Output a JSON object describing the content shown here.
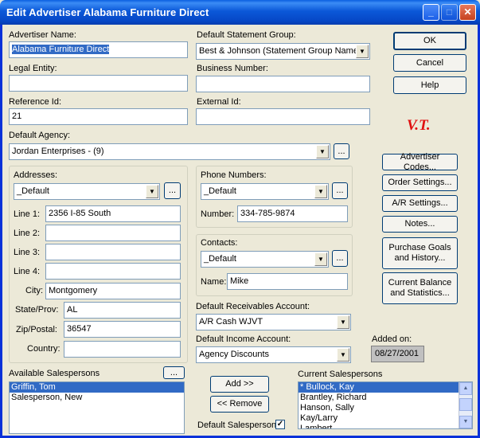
{
  "window": {
    "title": "Edit Advertiser Alabama Furniture Direct"
  },
  "fields": {
    "advertiser_name_label": "Advertiser Name:",
    "advertiser_name_value": "Alabama Furniture Direct",
    "legal_entity_label": "Legal Entity:",
    "legal_entity_value": "",
    "reference_id_label": "Reference Id:",
    "reference_id_value": "21",
    "default_statement_group_label": "Default Statement Group:",
    "default_statement_group_value": "Best & Johnson (Statement Group Name)",
    "business_number_label": "Business Number:",
    "business_number_value": "",
    "external_id_label": "External Id:",
    "external_id_value": "",
    "default_agency_label": "Default Agency:",
    "default_agency_value": "Jordan Enterprises - (9)"
  },
  "buttons": {
    "ok": "OK",
    "cancel": "Cancel",
    "help": "Help",
    "ellipsis": "...",
    "advertiser_codes": "Advertiser Codes...",
    "order_settings": "Order Settings...",
    "ar_settings": "A/R Settings...",
    "notes": "Notes...",
    "purchase_goals_1": "Purchase Goals",
    "purchase_goals_2": "and History...",
    "current_balance_1": "Current Balance",
    "current_balance_2": "and Statistics...",
    "add": "Add >>",
    "remove": "<< Remove"
  },
  "logo_text": "V.T.",
  "addresses": {
    "label": "Addresses:",
    "selected": "_Default",
    "line1_label": "Line 1:",
    "line1_value": "2356 I-85 South",
    "line2_label": "Line 2:",
    "line2_value": "",
    "line3_label": "Line 3:",
    "line3_value": "",
    "line4_label": "Line 4:",
    "line4_value": "",
    "city_label": "City:",
    "city_value": "Montgomery",
    "state_label": "State/Prov:",
    "state_value": "AL",
    "zip_label": "Zip/Postal:",
    "zip_value": "36547",
    "country_label": "Country:",
    "country_value": ""
  },
  "phone_numbers": {
    "label": "Phone Numbers:",
    "selected": "_Default",
    "number_label": "Number:",
    "number_value": "334-785-9874"
  },
  "contacts": {
    "label": "Contacts:",
    "selected": "_Default",
    "name_label": "Name:",
    "name_value": "Mike"
  },
  "receivables": {
    "label": "Default Receivables Account:",
    "value": "A/R Cash WJVT"
  },
  "income": {
    "label": "Default Income Account:",
    "value": "Agency Discounts"
  },
  "added_on": {
    "label": "Added on:",
    "value": "08/27/2001"
  },
  "available_salespersons": {
    "label": "Available Salespersons",
    "items": [
      "Griffin, Tom",
      "Salesperson, New"
    ],
    "selected_index": 0
  },
  "current_salespersons": {
    "label": "Current Salespersons",
    "items": [
      "* Bullock, Kay",
      "Brantley, Richard",
      "Hanson, Sally",
      "Kay/Larry",
      "Lambert, ..."
    ],
    "selected_index": 0
  },
  "default_salesperson": {
    "label": "Default Salesperson",
    "checked": true
  },
  "colors": {
    "titlebar": "#0a5fe0",
    "dialog_bg": "#ece9d8",
    "selection": "#316ac5",
    "logo": "#e01010"
  }
}
